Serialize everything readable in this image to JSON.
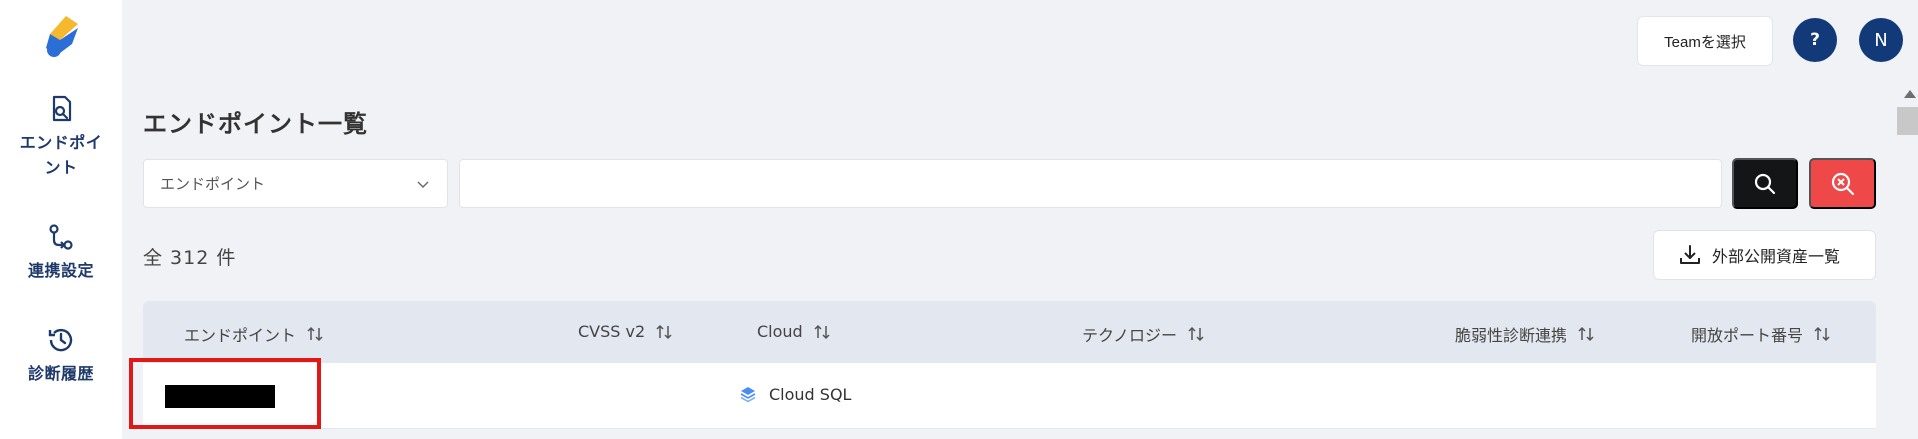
{
  "sidebar": {
    "items": [
      {
        "label": "エンドポイント",
        "icon": "endpoint-search-icon"
      },
      {
        "label": "連携設定",
        "icon": "integration-icon"
      },
      {
        "label": "診断履歴",
        "icon": "history-icon"
      }
    ]
  },
  "header": {
    "team_button": "Teamを選択",
    "help_label": "?",
    "avatar_initial": "N"
  },
  "main": {
    "title": "エンドポイント一覧",
    "filter_select": {
      "selected": "エンドポイント"
    },
    "search_input": {
      "value": "",
      "placeholder": ""
    },
    "count_text": "全 312 件",
    "export_button": "外部公開資産一覧"
  },
  "table": {
    "columns": [
      "エンドポイント",
      "CVSS v2",
      "Cloud",
      "テクノロジー",
      "脆弱性診断連携",
      "開放ポート番号"
    ],
    "rows": [
      {
        "endpoint": "",
        "cvss": "",
        "cloud": "Cloud SQL",
        "technology": "",
        "scan_link": "",
        "ports": ""
      }
    ]
  },
  "colors": {
    "accent_dark_blue": "#133a78",
    "search_button": "#131516",
    "clear_button": "#ee4848",
    "highlight_box": "#e01818"
  }
}
